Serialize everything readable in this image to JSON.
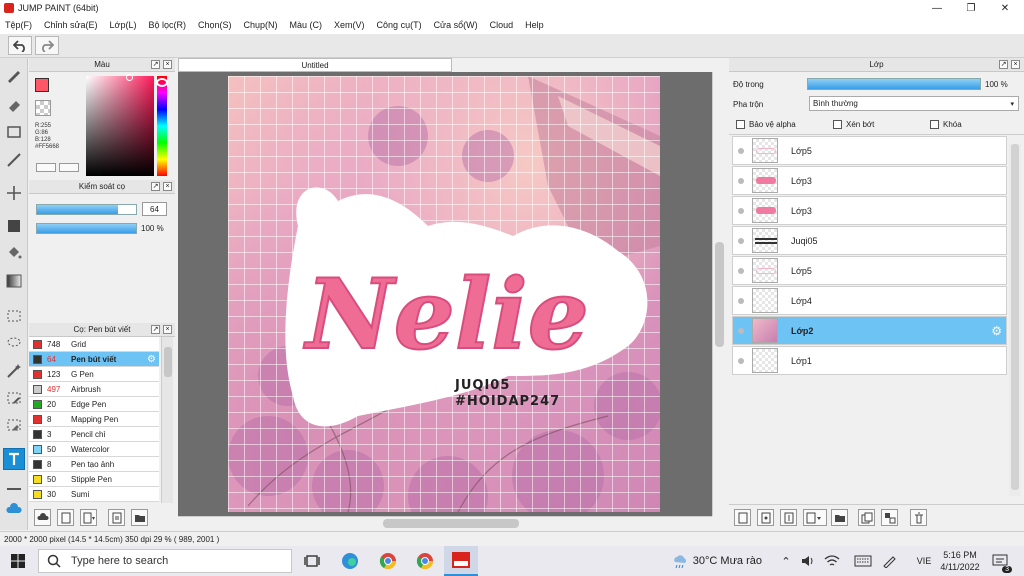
{
  "window": {
    "title": "JUMP PAINT (64bit)"
  },
  "menu": [
    "Tệp(F)",
    "Chỉnh sửa(E)",
    "Lớp(L)",
    "Bộ lọc(R)",
    "Chọn(S)",
    "Chụp(N)",
    "Màu (C)",
    "Xem(V)",
    "Công cụ(T)",
    "Cửa sổ(W)",
    "Cloud",
    "Help"
  ],
  "color_panel": {
    "title": "Màu",
    "r": "R:255",
    "g": "G:86",
    "b": "B:128",
    "hex": "#FF5668",
    "fg_color": "#ff5668"
  },
  "brush_control": {
    "title": "Kiểm soát cọ",
    "size_value": "64",
    "size_fraction": 0.82,
    "opacity_value": "100 %",
    "opacity_fraction": 1.0
  },
  "brush_panel": {
    "title": "Cọ: Pen bút viết",
    "brushes": [
      {
        "size": "748",
        "name": "Grid",
        "color": "#e03030"
      },
      {
        "size": "64",
        "name": "Pen bút viết",
        "color": "#333333",
        "selected": true
      },
      {
        "size": "123",
        "name": "G Pen",
        "color": "#e03030"
      },
      {
        "size": "497",
        "name": "Airbrush",
        "color": "#cccccc"
      },
      {
        "size": "20",
        "name": "Edge Pen",
        "color": "#22aa22"
      },
      {
        "size": "8",
        "name": "Mapping Pen",
        "color": "#e03030"
      },
      {
        "size": "3",
        "name": "Pencil chì",
        "color": "#333333"
      },
      {
        "size": "50",
        "name": "Watercolor",
        "color": "#7fd3f5"
      },
      {
        "size": "8",
        "name": "Pen tạo ảnh",
        "color": "#333333"
      },
      {
        "size": "50",
        "name": "Stipple Pen",
        "color": "#f2dd22"
      },
      {
        "size": "30",
        "name": "Sumi",
        "color": "#f2dd22"
      }
    ]
  },
  "document": {
    "tab": "Untitled"
  },
  "artwork": {
    "main_text": "Nelie",
    "credit_line1": "JUQI05",
    "credit_line2": "#HOIDAP247"
  },
  "layer_panel": {
    "title": "Lớp",
    "opacity_label": "Độ trong",
    "opacity_value": "100 %",
    "opacity_fraction": 1.0,
    "blend_label": "Pha trộn",
    "blend_value": "Bình thường",
    "protect_alpha": "Bảo vệ alpha",
    "clipping": "Xén bớt",
    "lock": "Khóa",
    "layers": [
      {
        "name": "Lớp5",
        "thumb": "sketch"
      },
      {
        "name": "Lớp3",
        "thumb": "pink-text"
      },
      {
        "name": "Lớp3",
        "thumb": "pink-text"
      },
      {
        "name": "Juqi05",
        "thumb": "credit"
      },
      {
        "name": "Lớp5",
        "thumb": "sketch"
      },
      {
        "name": "Lớp4",
        "thumb": "empty"
      },
      {
        "name": "Lớp2",
        "thumb": "photo",
        "selected": true
      },
      {
        "name": "Lớp1",
        "thumb": "empty"
      }
    ]
  },
  "status": {
    "text": "2000 * 2000 pixel  (14.5 * 14.5cm)  350 dpi  29 %  ( 989, 2001 )"
  },
  "taskbar": {
    "search_placeholder": "Type here to search",
    "weather": "30°C  Mưa rào",
    "lang": "VIE",
    "time": "5:16 PM",
    "date": "4/11/2022",
    "notif": "3"
  }
}
